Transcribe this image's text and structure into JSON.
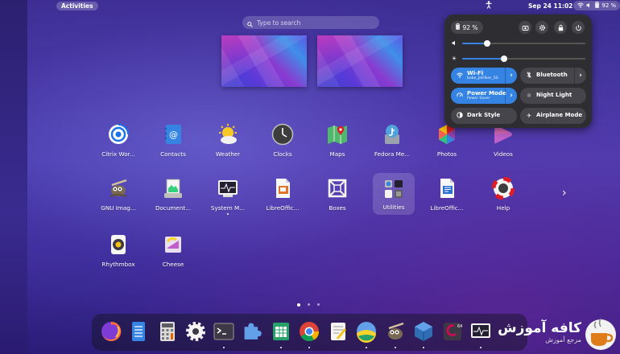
{
  "topbar": {
    "activities": "Activities",
    "clock": "Sep 24  11:02",
    "battery": "92 %"
  },
  "search": {
    "placeholder": "Type to search"
  },
  "apps": [
    {
      "label": "Citrix Wor...",
      "icon": "citrix-icon"
    },
    {
      "label": "Contacts",
      "icon": "contacts-icon"
    },
    {
      "label": "Weather",
      "icon": "weather-icon"
    },
    {
      "label": "Clocks",
      "icon": "clock-icon"
    },
    {
      "label": "Maps",
      "icon": "maps-icon"
    },
    {
      "label": "Fedora Me...",
      "icon": "fedora-media-writer-icon"
    },
    {
      "label": "Photos",
      "icon": "photos-icon"
    },
    {
      "label": "Videos",
      "icon": "videos-icon"
    },
    {
      "label": "GNU Imag...",
      "icon": "gimp-icon"
    },
    {
      "label": "Document...",
      "icon": "document-scanner-icon"
    },
    {
      "label": "System M...",
      "icon": "system-monitor-icon"
    },
    {
      "label": "LibreOffic...",
      "icon": "libreoffice-impress-icon"
    },
    {
      "label": "Boxes",
      "icon": "boxes-icon"
    },
    {
      "label": "Utilities",
      "icon": "utilities-folder-icon"
    },
    {
      "label": "LibreOffic...",
      "icon": "libreoffice-writer-icon"
    },
    {
      "label": "Help",
      "icon": "help-icon"
    },
    {
      "label": "Rhythmbox",
      "icon": "rhythmbox-icon"
    },
    {
      "label": "Cheese",
      "icon": "cheese-icon"
    }
  ],
  "dock": [
    "firefox-icon",
    "notes-icon",
    "calculator-icon",
    "settings-icon",
    "terminal-icon",
    "extensions-icon",
    "spreadsheet-icon",
    "chrome-icon",
    "text-editor-icon",
    "wallpaper-icon",
    "gimp-icon",
    "virtualbox-icon",
    "debian-icon",
    "system-monitor-icon"
  ],
  "quick_settings": {
    "battery": "92 %",
    "volume_level": 0.2,
    "brightness_level": 0.34,
    "tiles": [
      {
        "title": "Wi-Fi",
        "subtitle": "bobo_JeiFiber_5G",
        "on": true,
        "arrow": true
      },
      {
        "title": "Bluetooth",
        "subtitle": "",
        "on": false,
        "arrow": true
      },
      {
        "title": "Power Mode",
        "subtitle": "Power Saver",
        "on": true,
        "arrow": true
      },
      {
        "title": "Night Light",
        "subtitle": "",
        "on": false,
        "arrow": false
      },
      {
        "title": "Dark Style",
        "subtitle": "",
        "on": false,
        "arrow": false
      },
      {
        "title": "Airplane Mode",
        "subtitle": "",
        "on": false,
        "arrow": false
      }
    ]
  },
  "watermark": {
    "title": "کافه آموزش",
    "subtitle": "مرجع آموزش"
  },
  "colors": {
    "accent": "#3584e4",
    "panel": "#2e2e32"
  }
}
